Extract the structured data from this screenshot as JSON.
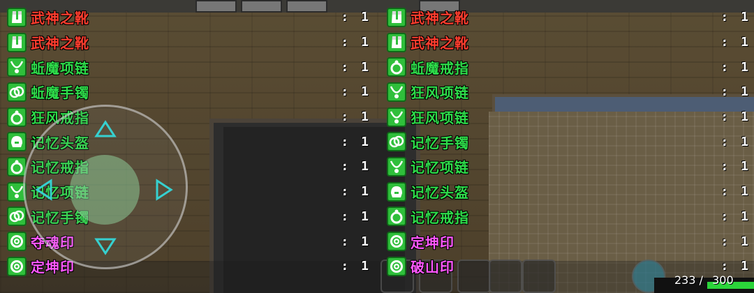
{
  "colors": {
    "red_item": "#ff3d2e",
    "green_item": "#2edc4a",
    "magenta_item": "#ff58ff",
    "icon_bg": "#2fbf3b"
  },
  "items_left": [
    {
      "name": "武神之靴",
      "qty": "1",
      "color": "red",
      "icon": "boots-icon"
    },
    {
      "name": "武神之靴",
      "qty": "1",
      "color": "red",
      "icon": "boots-icon"
    },
    {
      "name": "蚯魔项链",
      "qty": "1",
      "color": "green",
      "icon": "necklace-icon"
    },
    {
      "name": "蚯魔手镯",
      "qty": "1",
      "color": "green",
      "icon": "bracelet-icon"
    },
    {
      "name": "狂风戒指",
      "qty": "1",
      "color": "green",
      "icon": "ring-icon"
    },
    {
      "name": "记忆头盔",
      "qty": "1",
      "color": "green",
      "icon": "helmet-icon"
    },
    {
      "name": "记忆戒指",
      "qty": "1",
      "color": "green",
      "icon": "ring-icon"
    },
    {
      "name": "记忆项链",
      "qty": "1",
      "color": "green",
      "icon": "necklace-icon"
    },
    {
      "name": "记忆手镯",
      "qty": "1",
      "color": "green",
      "icon": "bracelet-icon"
    },
    {
      "name": "夺魂印",
      "qty": "1",
      "color": "magenta",
      "icon": "seal-icon"
    },
    {
      "name": "定坤印",
      "qty": "1",
      "color": "magenta",
      "icon": "seal-icon"
    }
  ],
  "items_right": [
    {
      "name": "武神之靴",
      "qty": "1",
      "color": "red",
      "icon": "boots-icon"
    },
    {
      "name": "武神之靴",
      "qty": "1",
      "color": "red",
      "icon": "boots-icon"
    },
    {
      "name": "蚯魔戒指",
      "qty": "1",
      "color": "green",
      "icon": "ring-icon"
    },
    {
      "name": "狂风项链",
      "qty": "1",
      "color": "green",
      "icon": "necklace-icon"
    },
    {
      "name": "狂风项链",
      "qty": "1",
      "color": "green",
      "icon": "necklace-icon"
    },
    {
      "name": "记忆手镯",
      "qty": "1",
      "color": "green",
      "icon": "bracelet-icon"
    },
    {
      "name": "记忆项链",
      "qty": "1",
      "color": "green",
      "icon": "necklace-icon"
    },
    {
      "name": "记忆头盔",
      "qty": "1",
      "color": "green",
      "icon": "helmet-icon"
    },
    {
      "name": "记忆戒指",
      "qty": "1",
      "color": "green",
      "icon": "ring-icon"
    },
    {
      "name": "定坤印",
      "qty": "1",
      "color": "magenta",
      "icon": "seal-icon"
    },
    {
      "name": "破山印",
      "qty": "1",
      "color": "magenta",
      "icon": "seal-icon"
    }
  ],
  "qty_separator": ":",
  "hp": {
    "current": "233",
    "separator": "/",
    "max": "300",
    "fraction": 0.777
  }
}
